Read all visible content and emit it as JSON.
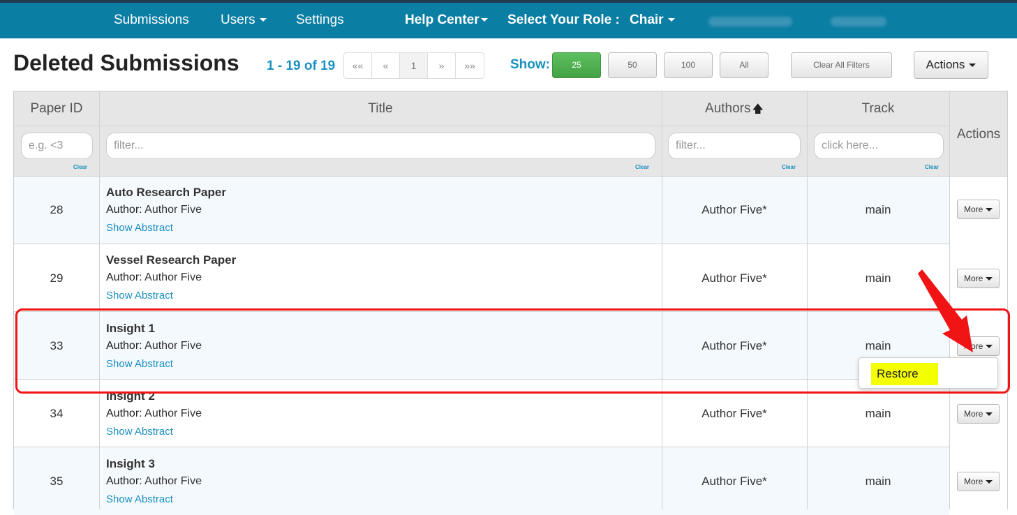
{
  "nav": {
    "submissions": "Submissions",
    "users": "Users",
    "settings": "Settings",
    "help_center": "Help Center",
    "role_label": "Select Your Role :",
    "role_value": "Chair"
  },
  "toolbar": {
    "title": "Deleted Submissions",
    "range": "1 - 19 of 19",
    "pager": [
      "««",
      "«",
      "1",
      "»",
      "»»"
    ],
    "show_label": "Show:",
    "show_options": [
      "25",
      "50",
      "100",
      "All"
    ],
    "selected_show": "25",
    "clear_filters": "Clear All Filters",
    "actions": "Actions"
  },
  "table": {
    "headers": {
      "paper_id": "Paper ID",
      "title": "Title",
      "authors": "Authors",
      "track": "Track",
      "actions": "Actions"
    },
    "filters": {
      "paper_id_placeholder": "e.g. <3",
      "title_placeholder": "filter...",
      "authors_placeholder": "filter...",
      "track_placeholder": "click here...",
      "clear_label": "Clear"
    },
    "author_prefix": "Author:",
    "show_abstract": "Show Abstract",
    "more": "More",
    "rows": [
      {
        "id": "28",
        "title": "Auto Research Paper",
        "author": "Author Five",
        "authors": "Author Five*",
        "track": "main"
      },
      {
        "id": "29",
        "title": "Vessel Research Paper",
        "author": "Author Five",
        "authors": "Author Five*",
        "track": "main"
      },
      {
        "id": "33",
        "title": "Insight 1",
        "author": "Author Five",
        "authors": "Author Five*",
        "track": "main"
      },
      {
        "id": "34",
        "title": "Insight 2",
        "author": "Author Five",
        "authors": "Author Five*",
        "track": "main"
      },
      {
        "id": "35",
        "title": "Insight 3",
        "author": "Author Five",
        "authors": "Author Five*",
        "track": "main"
      }
    ]
  },
  "dropdown": {
    "restore": "Restore"
  },
  "colors": {
    "nav_bg": "#0b7ea4",
    "accent": "#1a8fc0",
    "active_show": "#4cae4c",
    "annotation": "#f01414",
    "highlight": "#f4ff00"
  }
}
